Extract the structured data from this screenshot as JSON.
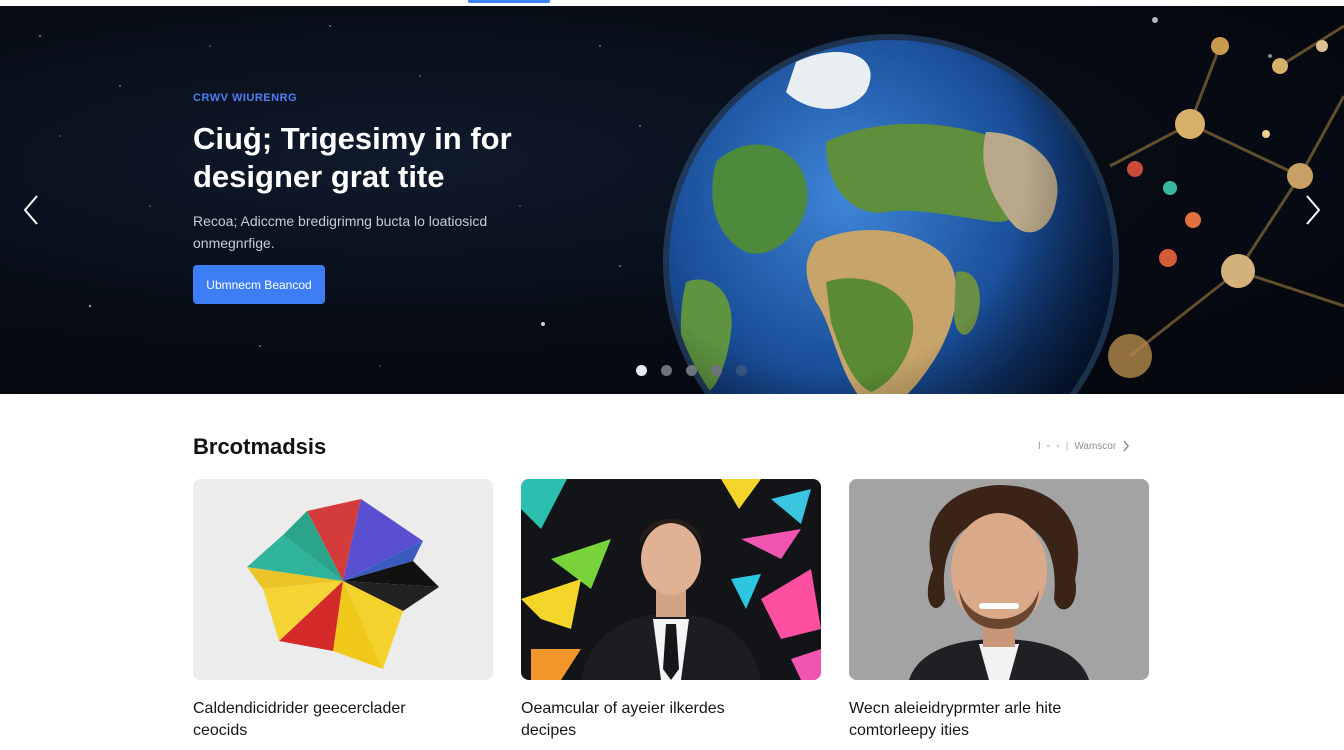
{
  "hero": {
    "eyebrow": "CRWV WIURENRG",
    "title": "Ciuġ; Trigesimy in for\ndesigner grat tite",
    "subtitle": "Recoa; Adiccme bredigrimng bucta lo loatiosicd\nonmegnrfige.",
    "cta_label": "Ubmnecm Beancod",
    "carousel_dots": 5,
    "active_dot": 0
  },
  "section": {
    "title": "Brcotmadsis",
    "nav_text": "Wamscor"
  },
  "cards": [
    {
      "caption": "Caldendicidrider geecerclader\nceocids"
    },
    {
      "caption": "Oeamcular of ayeier ilkerdes\ndecipes"
    },
    {
      "caption": "Wecn aleieidryprmter arle hite\ncomtorleepy ities"
    }
  ],
  "icons": {
    "prev": "chevron-left-icon",
    "next": "chevron-right-icon",
    "section_next": "chevron-right-icon"
  },
  "colors": {
    "accent": "#3d7ef7",
    "eyebrow": "#4f7df5",
    "hero_bg": "#070b14"
  }
}
